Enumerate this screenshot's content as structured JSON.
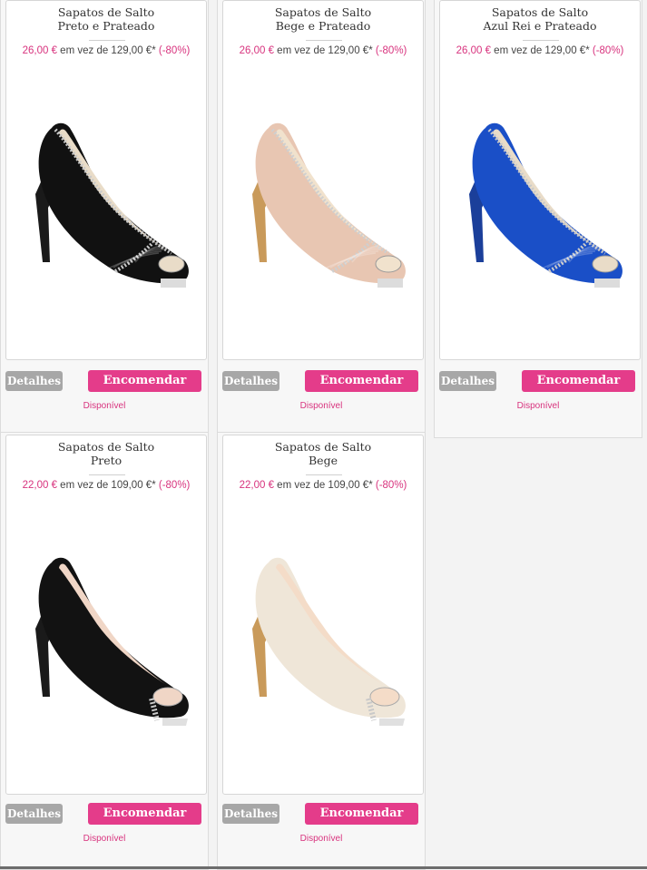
{
  "products": [
    {
      "title_line1": "Sapatos de Salto",
      "title_line2": "Preto e Prateado",
      "price_new": "26,00 €",
      "price_mid": " em vez de 129,00 €* ",
      "price_discount": "(-80%)",
      "details_label": "Detalhes",
      "order_label": "Encomendar",
      "availability": "Disponível",
      "colors": {
        "body": "#111111",
        "inner": "#e9dcc8",
        "trim": "#c9c9c9",
        "heel": "#1a1a1a"
      }
    },
    {
      "title_line1": "Sapatos de Salto",
      "title_line2": "Bege e Prateado",
      "price_new": "26,00 €",
      "price_mid": " em vez de 129,00 €* ",
      "price_discount": "(-80%)",
      "details_label": "Detalhes",
      "order_label": "Encomendar",
      "availability": "Disponível",
      "colors": {
        "body": "#e8c6b2",
        "inner": "#f1e2cd",
        "trim": "#cfcfcf",
        "heel": "#c99a5a"
      }
    },
    {
      "title_line1": "Sapatos de Salto",
      "title_line2": "Azul Rei e Prateado",
      "price_new": "26,00 €",
      "price_mid": " em vez de 129,00 €* ",
      "price_discount": "(-80%)",
      "details_label": "Detalhes",
      "order_label": "Encomendar",
      "availability": "Disponível",
      "colors": {
        "body": "#1a4fc7",
        "inner": "#e9dcc8",
        "trim": "#c9c9c9",
        "heel": "#1b3f9a"
      }
    },
    {
      "title_line1": "Sapatos de Salto",
      "title_line2": "Preto",
      "price_new": "22,00 €",
      "price_mid": " em vez de 109,00 €* ",
      "price_discount": "(-80%)",
      "details_label": "Detalhes",
      "order_label": "Encomendar",
      "availability": "Disponível",
      "colors": {
        "body": "#121212",
        "inner": "#f0d6c6",
        "trim": "#c9c9c9",
        "heel": "#1a1a1a"
      }
    },
    {
      "title_line1": "Sapatos de Salto",
      "title_line2": "Bege",
      "price_new": "22,00 €",
      "price_mid": " em vez de 109,00 €* ",
      "price_discount": "(-80%)",
      "details_label": "Detalhes",
      "order_label": "Encomendar",
      "availability": "Disponível",
      "colors": {
        "body": "#efe6d8",
        "inner": "#f4dcc8",
        "trim": "#c9c9c9",
        "heel": "#c99a5a"
      }
    }
  ]
}
